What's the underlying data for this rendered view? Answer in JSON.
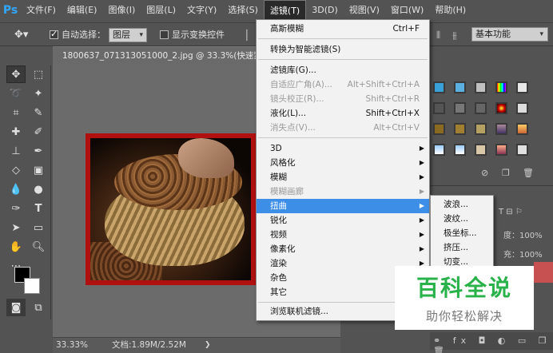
{
  "app": {
    "logo": "Ps"
  },
  "menubar": {
    "items": [
      "文件(F)",
      "编辑(E)",
      "图像(I)",
      "图层(L)",
      "文字(Y)",
      "选择(S)",
      "滤镜(T)",
      "3D(D)",
      "视图(V)",
      "窗口(W)",
      "帮助(H)"
    ],
    "active_index": 6
  },
  "options_bar": {
    "auto_select_label": "自动选择：",
    "auto_select_checked": true,
    "auto_select_target": "图层",
    "show_transform_label": "显示变换控件",
    "show_transform_checked": false,
    "workspace": "基本功能"
  },
  "document": {
    "tab_title": "1800637_071313051000_2.jpg @ 33.3%(快速蒙版/8",
    "zoom": "33.33%",
    "doc_info": "文档:1.89M/2.52M"
  },
  "filter_menu": {
    "items": [
      {
        "label": "高斯模糊",
        "shortcut": "Ctrl+F",
        "enabled": true
      },
      {
        "label": "转换为智能滤镜(S)",
        "enabled": true
      },
      {
        "label": "滤镜库(G)...",
        "enabled": true
      },
      {
        "label": "自适应广角(A)...",
        "shortcut": "Alt+Shift+Ctrl+A",
        "enabled": false
      },
      {
        "label": "镜头校正(R)...",
        "shortcut": "Shift+Ctrl+R",
        "enabled": false
      },
      {
        "label": "液化(L)...",
        "shortcut": "Shift+Ctrl+X",
        "enabled": true
      },
      {
        "label": "消失点(V)...",
        "shortcut": "Alt+Ctrl+V",
        "enabled": false
      },
      {
        "label": "3D",
        "submenu": true,
        "enabled": true
      },
      {
        "label": "风格化",
        "submenu": true,
        "enabled": true
      },
      {
        "label": "模糊",
        "submenu": true,
        "enabled": true
      },
      {
        "label": "模糊画廊",
        "submenu": true,
        "enabled": false
      },
      {
        "label": "扭曲",
        "submenu": true,
        "enabled": true,
        "highlighted": true
      },
      {
        "label": "锐化",
        "submenu": true,
        "enabled": true
      },
      {
        "label": "视频",
        "submenu": true,
        "enabled": true
      },
      {
        "label": "像素化",
        "submenu": true,
        "enabled": true
      },
      {
        "label": "渲染",
        "submenu": true,
        "enabled": true
      },
      {
        "label": "杂色",
        "submenu": true,
        "enabled": true
      },
      {
        "label": "其它",
        "submenu": true,
        "enabled": true
      },
      {
        "label": "浏览联机滤镜...",
        "enabled": true
      }
    ]
  },
  "distort_submenu": {
    "items": [
      "波浪...",
      "波纹...",
      "极坐标...",
      "挤压...",
      "切变..."
    ]
  },
  "right_panel": {
    "opacity_label": "度：100%",
    "fill_label": "充：100%",
    "colors": {
      "accent_red": "#b11010",
      "highlight": "#3d8ee6"
    }
  },
  "watermark": {
    "title": "百科全说",
    "subtitle": "助你轻松解决"
  }
}
